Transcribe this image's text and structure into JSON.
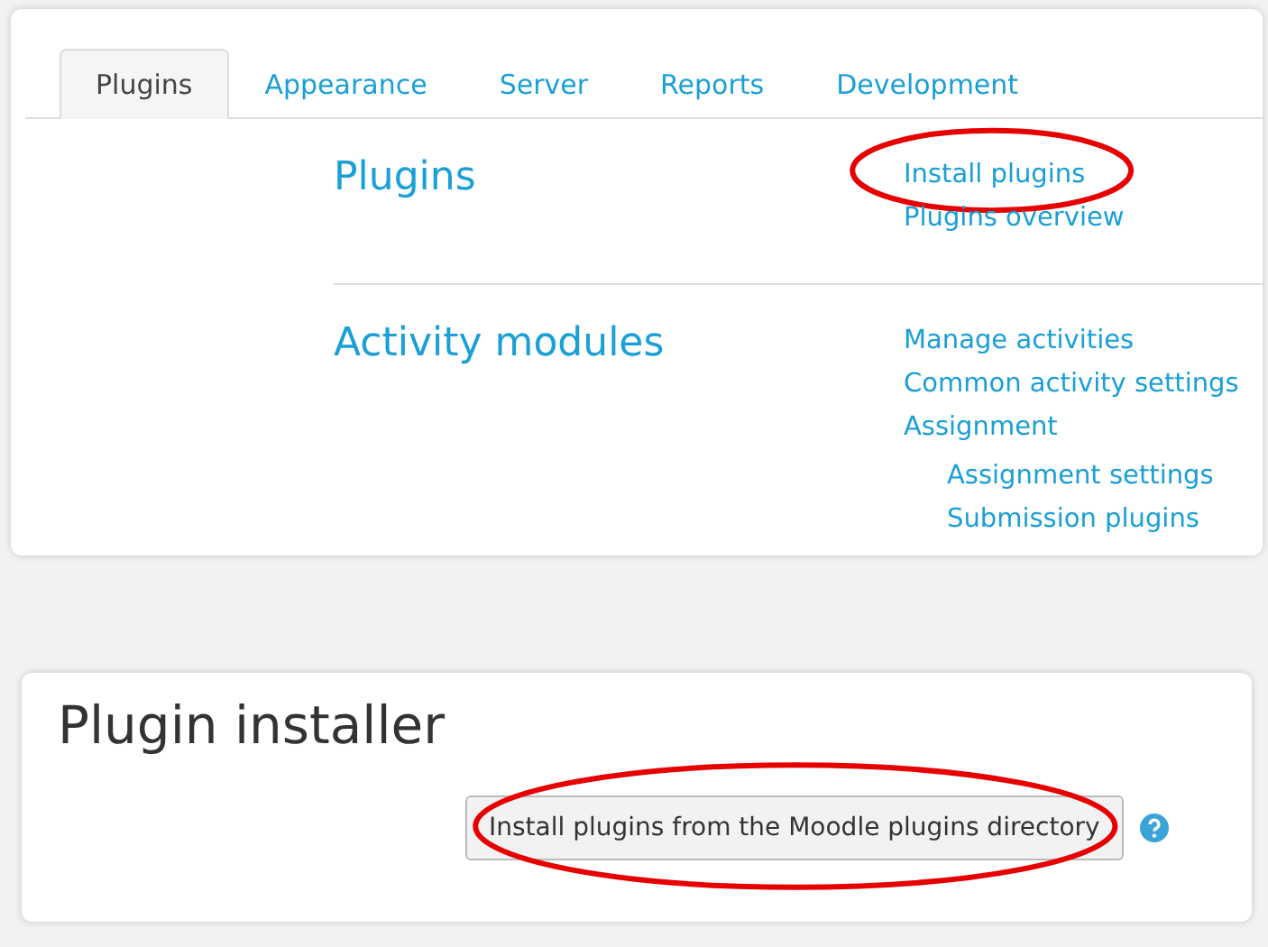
{
  "tabs": [
    {
      "label": "Plugins",
      "selected": true
    },
    {
      "label": "Appearance",
      "selected": false
    },
    {
      "label": "Server",
      "selected": false
    },
    {
      "label": "Reports",
      "selected": false
    },
    {
      "label": "Development",
      "selected": false
    }
  ],
  "sections": [
    {
      "title": "Plugins",
      "links": [
        {
          "label": "Install plugins",
          "highlighted": true
        },
        {
          "label": "Plugins overview",
          "highlighted": false
        }
      ]
    },
    {
      "title": "Activity modules",
      "links": [
        {
          "label": "Manage activities",
          "highlighted": false
        },
        {
          "label": "Common activity settings",
          "highlighted": false
        },
        {
          "label": "Assignment",
          "highlighted": false,
          "children": [
            {
              "label": "Assignment settings",
              "highlighted": false
            },
            {
              "label": "Submission plugins",
              "highlighted": false
            }
          ]
        }
      ]
    }
  ],
  "installer": {
    "title": "Plugin installer",
    "button": {
      "label": "Install plugins from the Moodle plugins directory",
      "highlighted": true
    }
  }
}
